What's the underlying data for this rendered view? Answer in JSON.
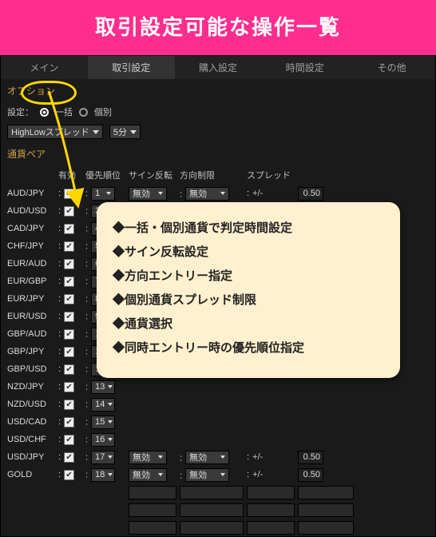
{
  "banner": {
    "title": "取引設定可能な操作一覧"
  },
  "tabs": [
    "メイン",
    "取引設定",
    "購入設定",
    "時間設定",
    "その他"
  ],
  "active_tab_index": 1,
  "section_option_label": "オプション",
  "settings": {
    "label": "設定：",
    "radio1": "一括",
    "radio2": "個別",
    "strategy": "HighLowスプレッド",
    "interval": "5分"
  },
  "pair_section_label": "通貨ペア",
  "columns": {
    "pair": "",
    "enable": "有効",
    "priority": "優先順位",
    "reverse": "サイン反転",
    "direction": "方向制限",
    "spread": "スプレッド",
    "val": ""
  },
  "rows": [
    {
      "pair": "AUD/JPY",
      "priority": "1",
      "reverse": "無効",
      "direction": "無効",
      "spread_pm": "+/-",
      "spread": "0.50"
    },
    {
      "pair": "AUD/USD",
      "priority": "3"
    },
    {
      "pair": "CAD/JPY",
      "priority": "4"
    },
    {
      "pair": "CHF/JPY",
      "priority": "5"
    },
    {
      "pair": "EUR/AUD",
      "priority": "6"
    },
    {
      "pair": "EUR/GBP",
      "priority": "7"
    },
    {
      "pair": "EUR/JPY",
      "priority": "8"
    },
    {
      "pair": "EUR/USD",
      "priority": "9"
    },
    {
      "pair": "GBP/AUD",
      "priority": "10"
    },
    {
      "pair": "GBP/JPY",
      "priority": "11"
    },
    {
      "pair": "GBP/USD",
      "priority": "12"
    },
    {
      "pair": "NZD/JPY",
      "priority": "13"
    },
    {
      "pair": "NZD/USD",
      "priority": "14"
    },
    {
      "pair": "USD/CAD",
      "priority": "15"
    },
    {
      "pair": "USD/CHF",
      "priority": "16"
    },
    {
      "pair": "USD/JPY",
      "priority": "17",
      "reverse": "無効",
      "direction": "無効",
      "spread_pm": "+/-",
      "spread": "0.50"
    },
    {
      "pair": "GOLD",
      "priority": "18",
      "reverse": "無効",
      "direction": "無効",
      "spread_pm": "+/-",
      "spread": "0.50"
    }
  ],
  "callout": {
    "items": [
      "◆一括・個別通貨で判定時間設定",
      "◆サイン反転設定",
      "◆方向エントリー指定",
      "◆個別通貨スプレッド制限",
      "◆通貨選択",
      "◆同時エントリー時の優先順位指定"
    ]
  }
}
